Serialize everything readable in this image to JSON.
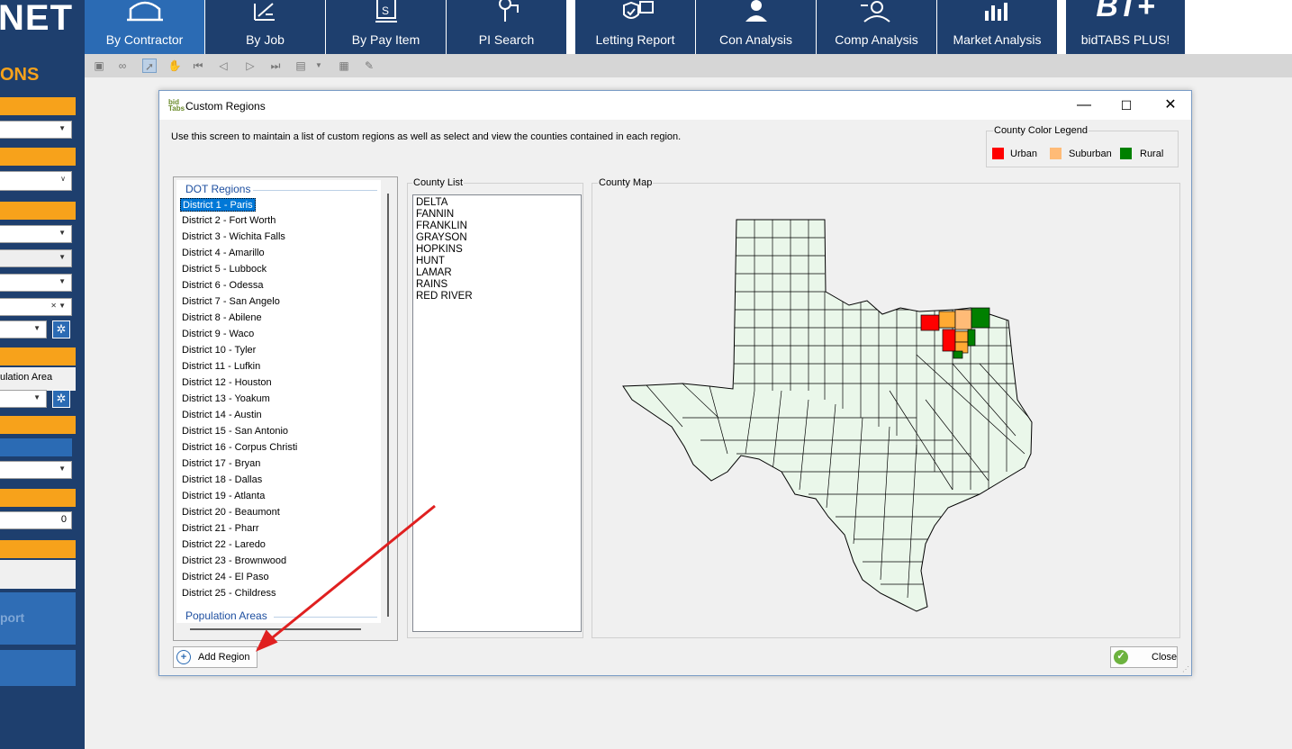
{
  "brand": {
    "partial_text": "NET"
  },
  "nav": {
    "items": [
      {
        "label": "By Contractor",
        "icon": "contractor-icon",
        "active": true
      },
      {
        "label": "By Job",
        "icon": "job-plans-icon"
      },
      {
        "label": "By Pay Item",
        "icon": "pay-item-icon"
      },
      {
        "label": "PI Search",
        "icon": "pi-search-icon"
      },
      {
        "label": "Letting Report",
        "icon": "letting-report-icon"
      },
      {
        "label": "Con Analysis",
        "icon": "con-analysis-icon"
      },
      {
        "label": "Comp Analysis",
        "icon": "comp-analysis-icon"
      },
      {
        "label": "Market Analysis",
        "icon": "market-analysis-icon"
      },
      {
        "label": "bidTABS PLUS!",
        "logo_text": "BT+"
      }
    ]
  },
  "left_panel": {
    "title_partial": "ONS",
    "population_label_partial": "ulation Area",
    "numeric_value": "0",
    "report_partial": "port"
  },
  "dialog": {
    "title": "Custom Regions",
    "description": "Use this screen to maintain a list of custom regions as well as select and view the counties contained in each region.",
    "legend": {
      "title": "County Color Legend",
      "items": [
        {
          "label": "Urban",
          "color": "#ff0000"
        },
        {
          "label": "Suburban",
          "color": "#ffbb77"
        },
        {
          "label": "Rural",
          "color": "#008000"
        }
      ]
    },
    "regions": {
      "group_dot": "DOT Regions",
      "group_population": "Population Areas",
      "selected_index": 0,
      "items": [
        "District 1 - Paris",
        "District 2 - Fort Worth",
        "District 3 - Wichita Falls",
        "District 4 - Amarillo",
        "District 5 - Lubbock",
        "District 6 - Odessa",
        "District 7 - San Angelo",
        "District 8 - Abilene",
        "District 9 - Waco",
        "District 10 - Tyler",
        "District 11 - Lufkin",
        "District 12 - Houston",
        "District 13 - Yoakum",
        "District 14 - Austin",
        "District 15 - San Antonio",
        "District 16 - Corpus Christi",
        "District 17 - Bryan",
        "District 18 - Dallas",
        "District 19 - Atlanta",
        "District 20 - Beaumont",
        "District 21 - Pharr",
        "District 22 - Laredo",
        "District 23 - Brownwood",
        "District 24 - El Paso",
        "District 25 - Childress"
      ]
    },
    "county_list": {
      "caption": "County List",
      "items": [
        "DELTA",
        "FANNIN",
        "FRANKLIN",
        "GRAYSON",
        "HOPKINS",
        "HUNT",
        "LAMAR",
        "RAINS",
        "RED RIVER"
      ]
    },
    "county_map": {
      "caption": "County Map",
      "base_color": "#eaf7ea",
      "outline_color": "#000000"
    },
    "buttons": {
      "add_region": "Add Region",
      "close": "Close"
    }
  },
  "colors": {
    "nav_bg": "#1e3f6e",
    "nav_active": "#2b6bb4",
    "accent_orange": "#f7a21b",
    "selection": "#0078d7",
    "annotation_arrow": "#e02020"
  }
}
